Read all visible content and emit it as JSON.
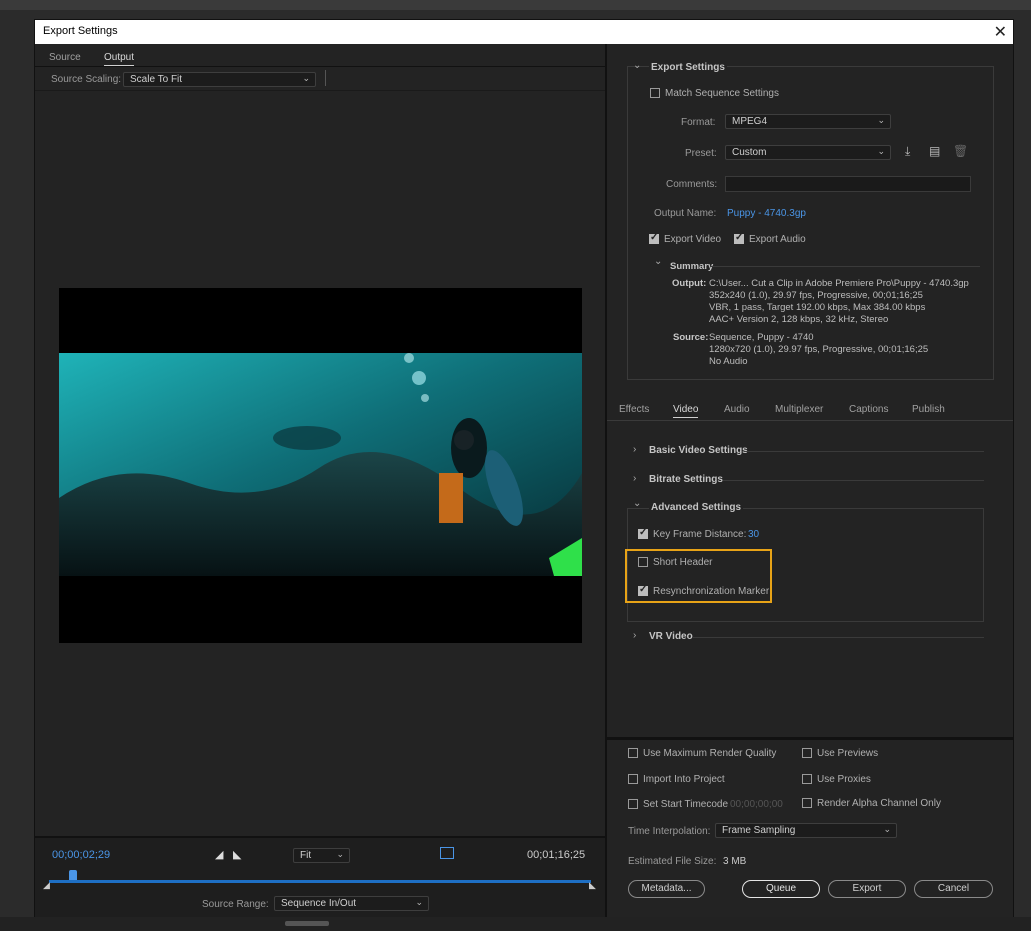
{
  "dialog": {
    "title": "Export Settings"
  },
  "left": {
    "tabs": [
      "Source",
      "Output"
    ],
    "active_tab": "Output",
    "source_scaling_label": "Source Scaling:",
    "source_scaling_value": "Scale To Fit",
    "timecode_current": "00;00;02;29",
    "timecode_end": "00;01;16;25",
    "fit_value": "Fit",
    "source_range_label": "Source Range:",
    "source_range_value": "Sequence In/Out",
    "playhead_fraction": 0.045
  },
  "export_settings": {
    "header": "Export Settings",
    "match_sequence": {
      "label": "Match Sequence Settings",
      "checked": false
    },
    "format_label": "Format:",
    "format_value": "MPEG4",
    "preset_label": "Preset:",
    "preset_value": "Custom",
    "comments_label": "Comments:",
    "comments_value": "",
    "output_name_label": "Output Name:",
    "output_name_value": "Puppy - 4740.3gp",
    "export_video": {
      "label": "Export Video",
      "checked": true
    },
    "export_audio": {
      "label": "Export Audio",
      "checked": true
    },
    "summary_header": "Summary",
    "summary_output_label": "Output:",
    "summary_output_lines": [
      "C:\\User... Cut a Clip in Adobe Premiere Pro\\Puppy - 4740.3gp",
      "352x240 (1.0), 29.97 fps, Progressive, 00;01;16;25",
      "VBR, 1 pass, Target 192.00 kbps, Max 384.00 kbps",
      "AAC+ Version 2, 128 kbps, 32 kHz, Stereo"
    ],
    "summary_source_label": "Source:",
    "summary_source_lines": [
      "Sequence, Puppy - 4740",
      "1280x720 (1.0), 29.97 fps, Progressive, 00;01;16;25",
      "No Audio"
    ]
  },
  "settings_tabs": [
    "Effects",
    "Video",
    "Audio",
    "Multiplexer",
    "Captions",
    "Publish"
  ],
  "active_settings_tab": "Video",
  "video": {
    "basic_video_settings": "Basic Video Settings",
    "bitrate_settings": "Bitrate Settings",
    "advanced_settings": "Advanced Settings",
    "key_frame_distance": {
      "label": "Key Frame Distance:",
      "value": "30",
      "checked": true
    },
    "short_header": {
      "label": "Short Header",
      "checked": false
    },
    "resync_marker": {
      "label": "Resynchronization Marker",
      "checked": true
    },
    "vr_video": "VR Video"
  },
  "bottom": {
    "use_max_render_quality": {
      "label": "Use Maximum Render Quality",
      "checked": false
    },
    "use_previews": {
      "label": "Use Previews",
      "checked": false
    },
    "import_into_project": {
      "label": "Import Into Project",
      "checked": false
    },
    "use_proxies": {
      "label": "Use Proxies",
      "checked": false
    },
    "set_start_timecode": {
      "label": "Set Start Timecode",
      "checked": false,
      "value": "00;00;00;00"
    },
    "render_alpha_only": {
      "label": "Render Alpha Channel Only",
      "checked": false
    },
    "time_interpolation_label": "Time Interpolation:",
    "time_interpolation_value": "Frame Sampling",
    "estimated_file_size_label": "Estimated File Size:",
    "estimated_file_size_value": "3 MB",
    "buttons": {
      "metadata": "Metadata...",
      "queue": "Queue",
      "export": "Export",
      "cancel": "Cancel"
    }
  },
  "colors": {
    "accent": "#4a95e6",
    "highlight": "#e8a317",
    "teal": "#1fb3b8"
  }
}
